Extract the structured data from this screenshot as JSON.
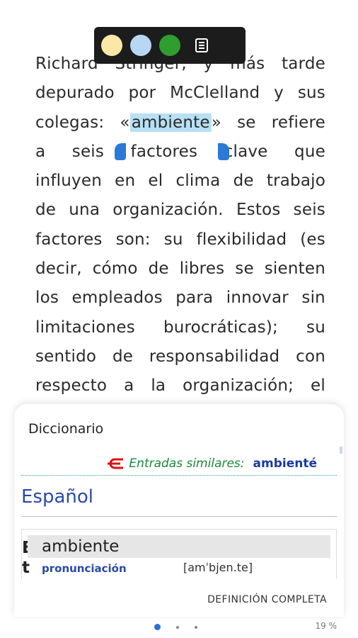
{
  "reader": {
    "lines": [
      [
        "Richard",
        "Stringer,",
        "y",
        "más",
        "tarde"
      ],
      [
        "depurado",
        "por",
        "McClelland",
        "y",
        "sus"
      ],
      [
        "colegas:",
        "«ambiente»",
        "se",
        "refiere"
      ],
      [
        "a",
        "seis",
        "factores",
        "clave",
        "que"
      ],
      [
        "influyen",
        "en",
        "el",
        "clima",
        "de",
        "trabajo"
      ],
      [
        "de",
        "una",
        "organización.",
        "Estos",
        "seis"
      ],
      [
        "factores",
        "son:",
        "su",
        "flexibilidad",
        "(es"
      ],
      [
        "decir,",
        "cómo",
        "de",
        "libres",
        "se",
        "sienten"
      ],
      [
        "los",
        "empleados",
        "para",
        "innovar",
        "sin"
      ],
      [
        "limitaciones",
        "burocráticas);",
        "su"
      ],
      [
        "sentido",
        "de",
        "responsabilidad",
        "con"
      ],
      [
        "respecto",
        "a",
        "la",
        "organización;",
        "el"
      ]
    ],
    "highlighted_word": "ambiente"
  },
  "toolbar": {
    "colors": [
      "#fbe8a6",
      "#b7d7f2",
      "#2e9e2e"
    ],
    "note_icon": "note-icon"
  },
  "dictionary": {
    "title": "Diccionario",
    "similar_label": "Entradas similares:",
    "similar_word": "ambienté",
    "language": "Español",
    "side_letters": "E\nt",
    "headword": "ambiente",
    "pron_label": "pronunciación",
    "pron_value": "[amˈbjen.te]",
    "full_definition": "DEFINICIÓN COMPLETA"
  },
  "footer": {
    "page_dots": 3,
    "active_dot": 0,
    "progress": "19 %"
  }
}
